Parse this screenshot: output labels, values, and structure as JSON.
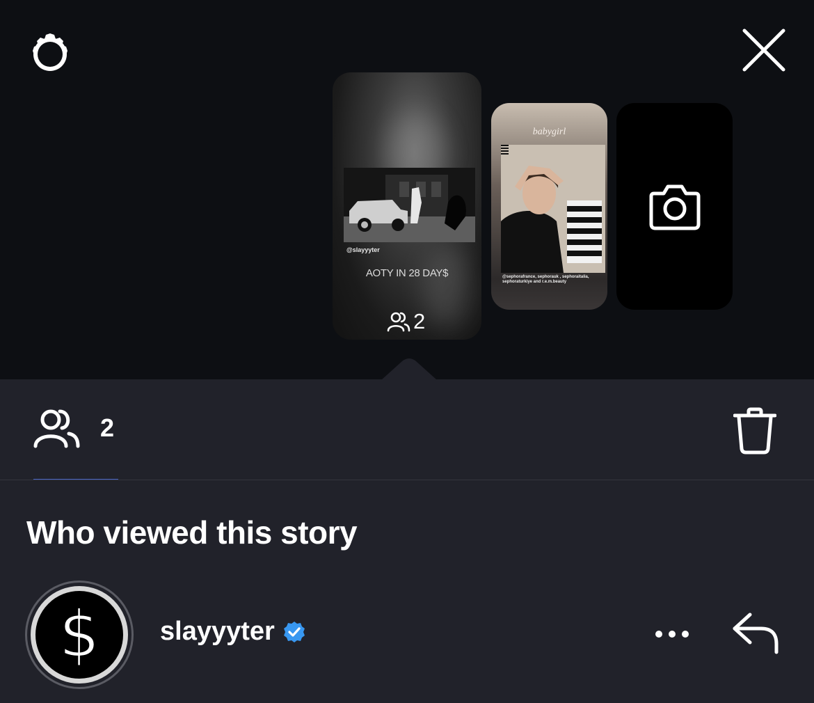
{
  "top_bar": {
    "settings_icon": "gear-icon",
    "close_icon": "close-icon"
  },
  "story_cards": [
    {
      "handle": "@slayyyter",
      "caption": "AOTY IN 28 DAY$",
      "viewer_count": "2"
    },
    {
      "title": "babygirl",
      "tags": "@sephorafrance, sephorauk , sephoraitalia, sephoraturkiye and r.e.m.beauty"
    },
    {
      "icon": "camera-icon"
    }
  ],
  "stats": {
    "viewers_count": "2",
    "trash_icon": "trash-icon"
  },
  "section_title": "Who viewed this story",
  "viewers": [
    {
      "avatar_symbol": "$",
      "username": "slayyyter",
      "verified": true
    }
  ],
  "colors": {
    "top_background": "#0d0f13",
    "panel_background": "#21222a",
    "tab_underline": "#4a66c8",
    "verified_badge": "#3897f0"
  }
}
